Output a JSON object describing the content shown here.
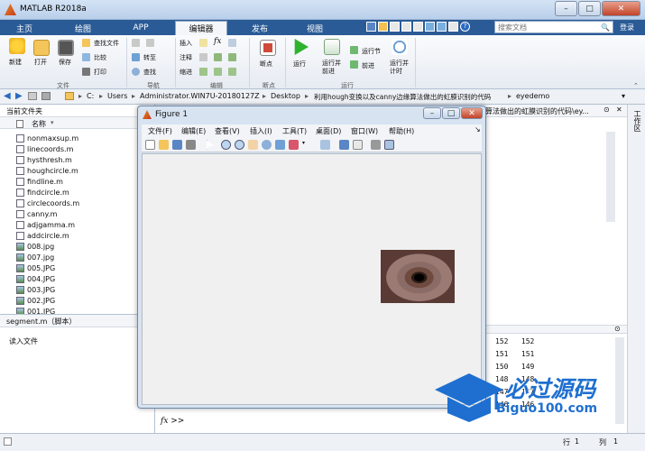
{
  "window": {
    "title": "MATLAB R2018a"
  },
  "tabs": [
    "主页",
    "绘图",
    "APP",
    "编辑器",
    "发布",
    "视图"
  ],
  "search": {
    "placeholder": "搜索文档"
  },
  "login": "登录",
  "ribbon": {
    "new": "新建",
    "open": "打开",
    "save": "保存",
    "find_files": "查找文件",
    "compare": "比较",
    "print": "打印",
    "goto": "转至",
    "find": "查找",
    "insert": "插入",
    "comment": "注释",
    "indent": "缩进",
    "breakpoints": "断点",
    "run": "运行",
    "run_advance": "运行并\n前进",
    "run_section": "运行节",
    "advance": "前进",
    "run_time": "运行并\n计时",
    "groups": {
      "file": "文件",
      "navigate": "导航",
      "edit": "编辑",
      "breakpoints": "断点",
      "run": "运行"
    }
  },
  "address": {
    "path": [
      "C:",
      "Users",
      "Administrator.WIN7U-20180127Z",
      "Desktop",
      "利用hough变换以及canny边缘算法做出的虹膜识别的代码",
      "eyedemo"
    ]
  },
  "current_folder": {
    "title": "当前文件夹",
    "column": "名称",
    "files": [
      "nonmaxsup.m",
      "linecoords.m",
      "hysthresh.m",
      "houghcircle.m",
      "findline.m",
      "findcircle.m",
      "circlecoords.m",
      "canny.m",
      "adjgamma.m",
      "addcircle.m",
      "008.jpg",
      "007.jpg",
      "005.JPG",
      "004.JPG",
      "003.JPG",
      "002.JPG",
      "001.JPG"
    ]
  },
  "details": {
    "file": "segment.m（脚本）",
    "description": "读入文件"
  },
  "editor_tab": "算法做出的虹膜识别的代码\\ey...",
  "workspace_label": "工作区",
  "cmd": {
    "numbers": [
      [
        "152",
        "152"
      ],
      [
        "151",
        "151"
      ],
      [
        "150",
        "149"
      ],
      [
        "148",
        "148"
      ],
      [
        "147",
        "147"
      ],
      [
        "146",
        "146"
      ]
    ],
    "prompt": "fx >>"
  },
  "status": {
    "row_label": "行",
    "row": "1",
    "col_label": "列",
    "col": "1"
  },
  "figure": {
    "title": "Figure 1",
    "menus": [
      "文件(F)",
      "编辑(E)",
      "查看(V)",
      "插入(I)",
      "工具(T)",
      "桌面(D)",
      "窗口(W)",
      "帮助(H)"
    ]
  },
  "watermark": {
    "text": "必过源码",
    "url": "Biguo100.com"
  }
}
